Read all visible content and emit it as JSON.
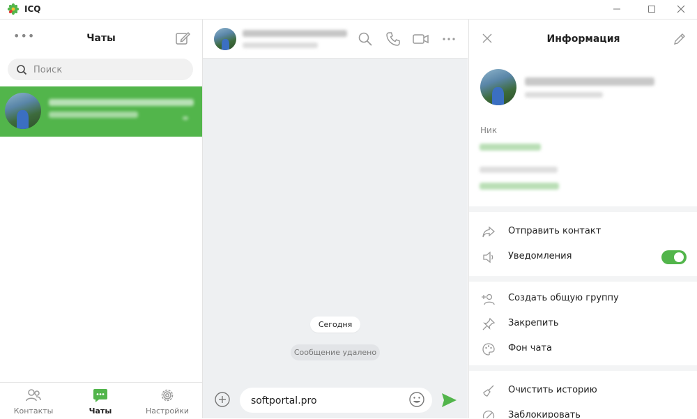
{
  "app": {
    "title": "ICQ",
    "brand_color": "#52b54b"
  },
  "window_controls": [
    "minimize-icon",
    "maximize-icon",
    "close-icon"
  ],
  "left": {
    "title": "Чаты",
    "search_placeholder": "Поиск",
    "nav": [
      {
        "label": "Контакты",
        "icon": "contacts-icon",
        "active": false
      },
      {
        "label": "Чаты",
        "icon": "chats-icon",
        "active": true
      },
      {
        "label": "Настройки",
        "icon": "settings-icon",
        "active": false
      }
    ]
  },
  "conversation": {
    "date_label": "Сегодня",
    "deleted_label": "Сообщение удалено",
    "composer_value": "softportal.pro",
    "icons": [
      "search-icon",
      "call-icon",
      "video-icon",
      "more-icon"
    ]
  },
  "info": {
    "title": "Информация",
    "nick_label": "Ник",
    "actions_1": [
      {
        "label": "Отправить контакт",
        "icon": "share-icon"
      },
      {
        "label": "Уведомления",
        "icon": "speaker-icon",
        "toggle": true
      }
    ],
    "actions_2": [
      {
        "label": "Создать общую группу",
        "icon": "add-group-icon"
      },
      {
        "label": "Закрепить",
        "icon": "pin-icon"
      },
      {
        "label": "Фон чата",
        "icon": "palette-icon"
      }
    ],
    "actions_3": [
      {
        "label": "Очистить историю",
        "icon": "broom-icon"
      },
      {
        "label": "Заблокировать",
        "icon": "block-icon"
      }
    ]
  }
}
